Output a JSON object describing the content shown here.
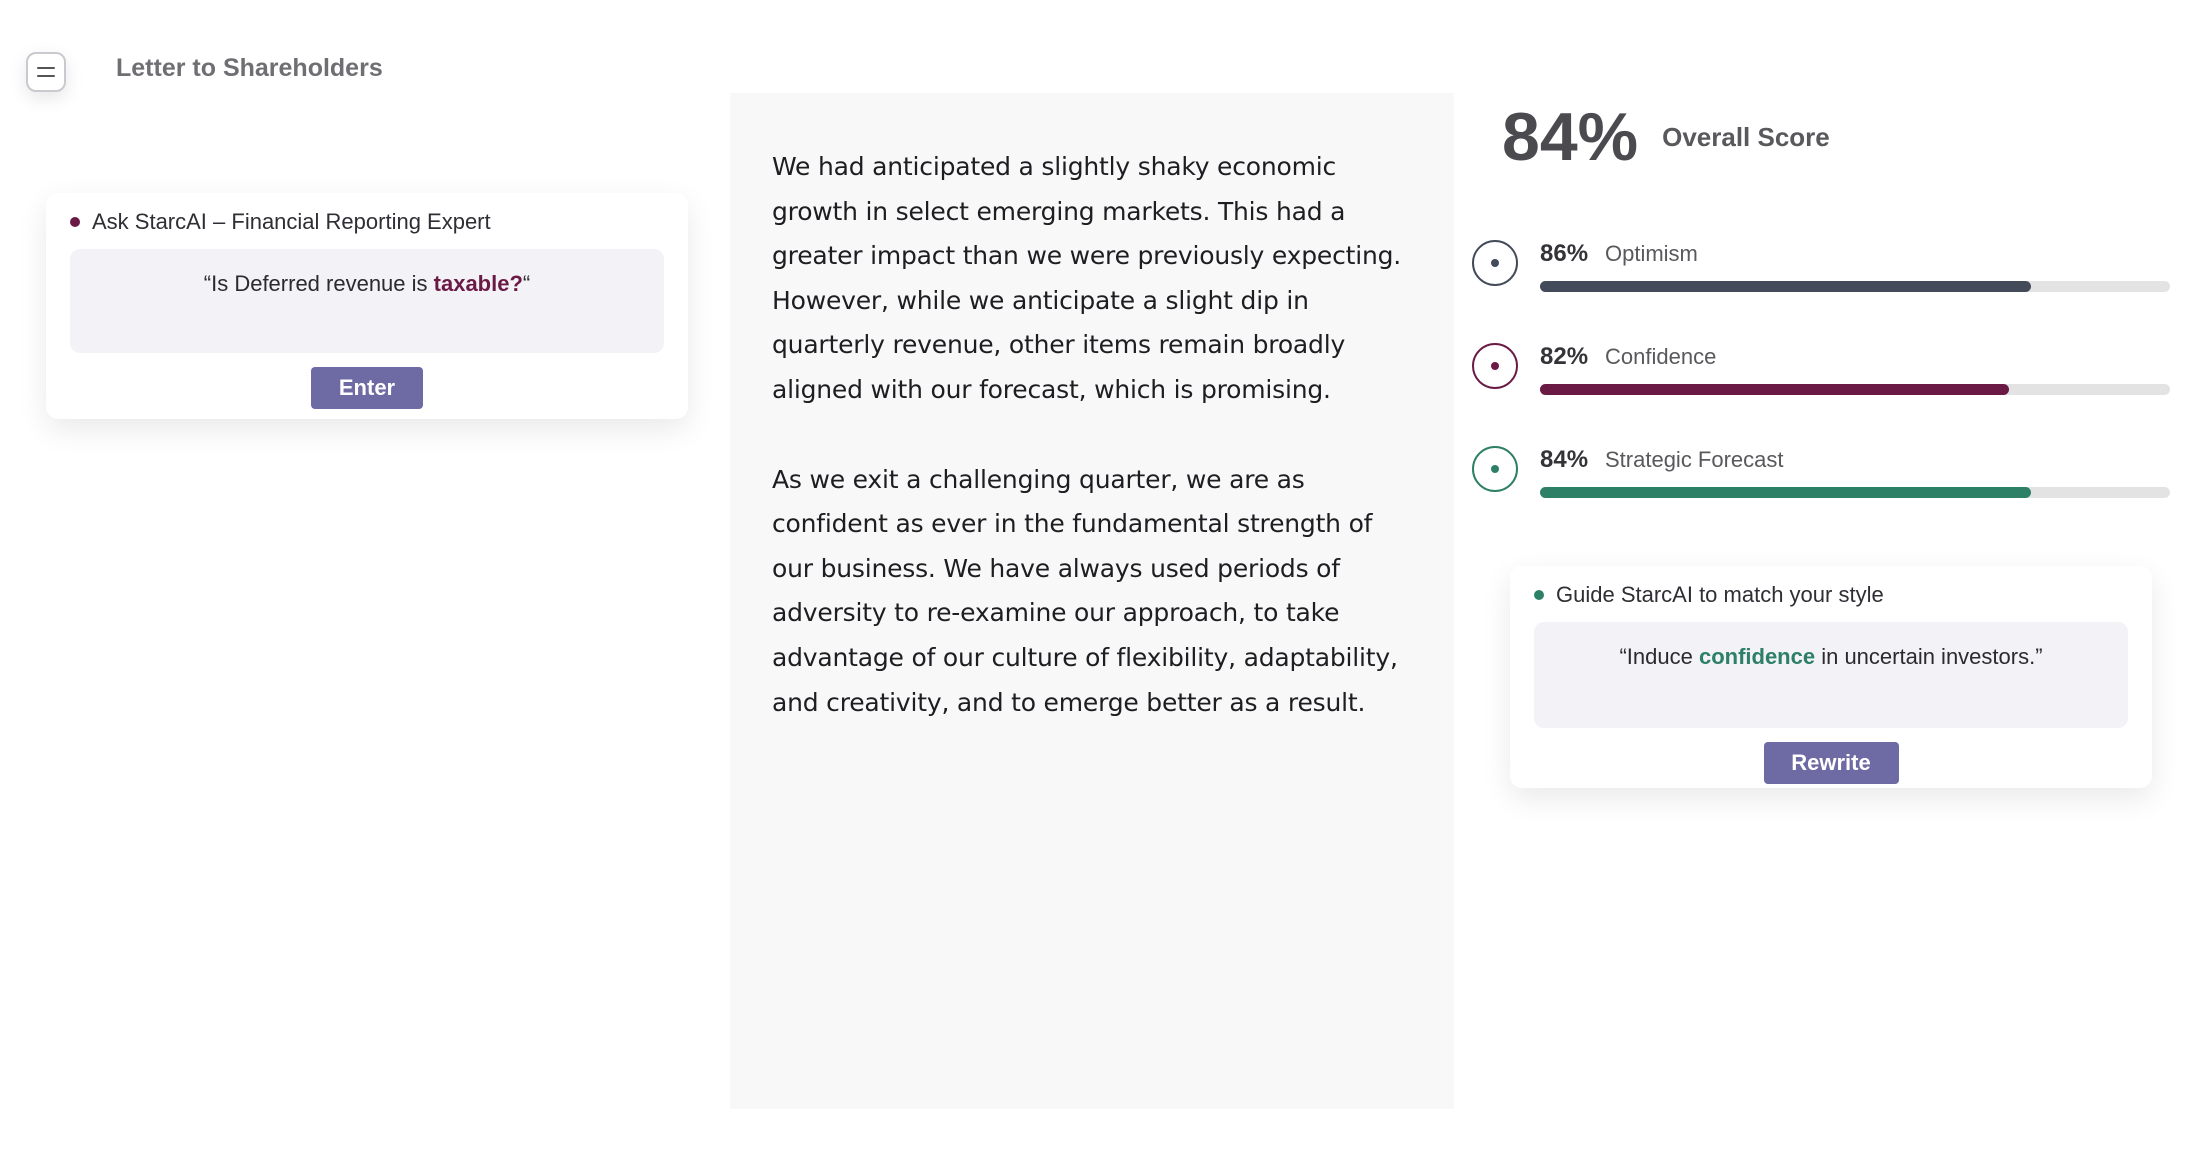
{
  "header": {
    "title": "Letter to Shareholders",
    "menu_icon": "menu-icon"
  },
  "ask": {
    "title": "Ask StarcAI – Financial Reporting Expert",
    "dot_color": "#6b1a45",
    "prompt_prefix": "“Is Deferred revenue is ",
    "prompt_highlight": "taxable?",
    "prompt_suffix": "“",
    "highlight_color": "#6b1a45",
    "button": "Enter"
  },
  "document": {
    "paragraphs": [
      "We had anticipated a slightly shaky economic growth in select emerging markets. This had a greater impact than we were previously expecting. However, while we anticipate a slight dip in quarterly revenue, other items remain broadly aligned with our forecast, which is promising.",
      "As we exit a challenging quarter, we are as confident as ever in the fundamental strength of our business. We have always used periods of adversity to re-examine our approach, to take advantage of our culture of flexibility, adaptability, and creativity, and to emerge better as a result."
    ]
  },
  "score": {
    "value": "84%",
    "label": "Overall Score"
  },
  "metrics": [
    {
      "value": "86%",
      "label": "Optimism",
      "fill": 0.78,
      "color": "#434a5a"
    },
    {
      "value": "82%",
      "label": "Confidence",
      "fill": 0.745,
      "color": "#6b1a45"
    },
    {
      "value": "84%",
      "label": "Strategic Forecast",
      "fill": 0.78,
      "color": "#2d7f66"
    }
  ],
  "guide": {
    "title": "Guide StarcAI to match your style",
    "dot_color": "#2d7f66",
    "prompt_prefix": "“Induce ",
    "prompt_highlight": "confidence",
    "prompt_suffix": " in uncertain investors.”",
    "highlight_color": "#2d7f66",
    "button": "Rewrite"
  }
}
